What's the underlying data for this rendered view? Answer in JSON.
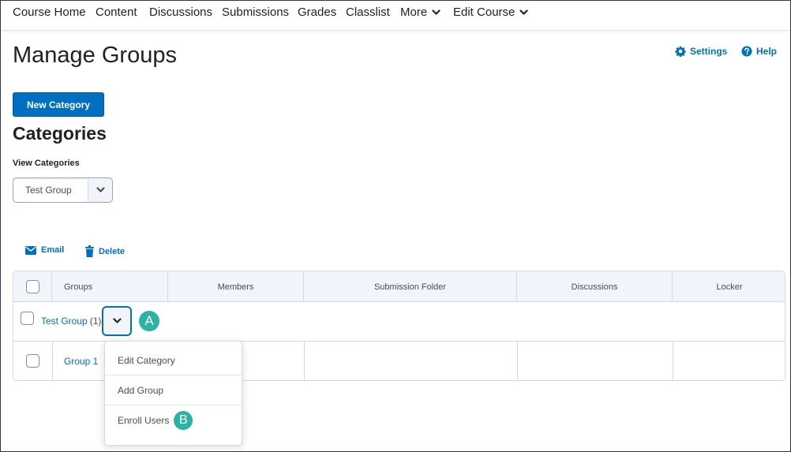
{
  "nav": {
    "items": [
      "Course Home",
      "Content",
      "Discussions",
      "Submissions",
      "Grades",
      "Classlist"
    ],
    "more": "More",
    "edit_course": "Edit Course"
  },
  "page": {
    "title": "Manage Groups",
    "settings": "Settings",
    "help": "Help"
  },
  "new_category_label": "New Category",
  "categories_heading": "Categories",
  "view_categories": {
    "label": "View Categories",
    "selected": "Test Group"
  },
  "actions": {
    "email": "Email",
    "delete": "Delete"
  },
  "table": {
    "columns": [
      "Groups",
      "Members",
      "Submission Folder",
      "Discussions",
      "Locker"
    ],
    "category": {
      "name": "Test Group",
      "count": "(1)"
    },
    "groups": [
      {
        "name": "Group 1"
      }
    ]
  },
  "context_menu": {
    "items": [
      "Edit Category",
      "Add Group",
      "Enroll Users"
    ]
  },
  "markers": {
    "a": "A",
    "b": "B"
  },
  "colors": {
    "accent": "#006fbf",
    "marker": "#2db3a3"
  }
}
